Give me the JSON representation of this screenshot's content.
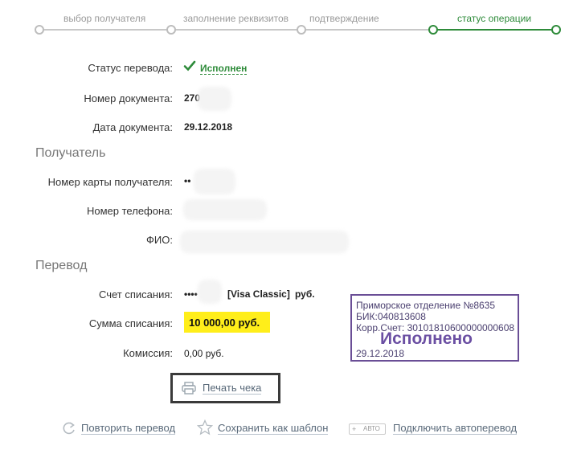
{
  "steps": [
    {
      "label": "выбор получателя",
      "active": false
    },
    {
      "label": "заполнение реквизитов",
      "active": false
    },
    {
      "label": "подтверждение",
      "active": false
    },
    {
      "label": "статус операции",
      "active": true
    }
  ],
  "status": {
    "label": "Статус перевода:",
    "value": "Исполнен",
    "icon": "check-icon"
  },
  "document": {
    "number_label": "Номер документа:",
    "number_value": "270",
    "date_label": "Дата документа:",
    "date_value": "29.12.2018"
  },
  "recipient": {
    "section_title": "Получатель",
    "card_label": "Номер карты получателя:",
    "card_value": "••",
    "phone_label": "Номер телефона:",
    "name_label": "ФИО:"
  },
  "transfer": {
    "section_title": "Перевод",
    "account_label": "Счет списания:",
    "account_prefix": "••••",
    "account_type": "[Visa Classic]",
    "account_currency": "руб.",
    "amount_label": "Сумма списания:",
    "amount_value": "10 000,00  руб.",
    "fee_label": "Комиссия:",
    "fee_value": "0,00 руб."
  },
  "stamp": {
    "line1": "Приморское отделение №8635",
    "line2": "БИК:040813608",
    "line3": "Корр.Счет: 30101810600000000608",
    "title": "Исполнено",
    "date": "29.12.2018"
  },
  "print": {
    "label": "Печать чека",
    "icon": "printer-icon"
  },
  "actions": {
    "repeat": "Повторить перевод",
    "repeat_icon": "refresh-icon",
    "template": "Сохранить как шаблон",
    "template_icon": "star-icon",
    "auto_badge_plus": "+",
    "auto_badge_text": "АВТО",
    "auto": "Подключить автоперевод"
  },
  "colors": {
    "accent": "#2e8b3a",
    "highlight": "#ffee1a",
    "stamp": "#6b4fa3"
  }
}
